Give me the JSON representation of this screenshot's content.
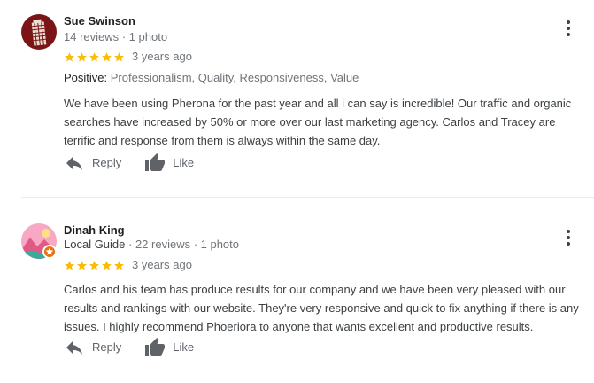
{
  "reviews": [
    {
      "author": "Sue Swinson",
      "local_guide": "",
      "meta": "14 reviews · 1 photo",
      "rating": 5,
      "date": "3 years ago",
      "positive_label": "Positive:",
      "positive_items": "Professionalism, Quality, Responsiveness, Value",
      "text": "We have been using Pherona for the past year and all i can say is incredible! Our traffic and organic searches have increased by 50% or more over our last marketing agency. Carlos and Tracey are terrific and response from them is always within the same day.",
      "reply_label": "Reply",
      "like_label": "Like"
    },
    {
      "author": "Dinah King",
      "local_guide": "Local Guide",
      "meta": " · 22 reviews · 1 photo",
      "rating": 5,
      "date": "3 years ago",
      "text": "Carlos and his team has produce results for our company and we have been very pleased with our results and rankings with our website. They're very responsive and quick to fix anything if there is any issues. I highly recommend Phoeriora to anyone that wants excellent and productive results.",
      "reply_label": "Reply",
      "like_label": "Like"
    }
  ],
  "colors": {
    "star": "#fbbc04",
    "name": "#202124",
    "secondary": "#70757a",
    "body": "#3c4043",
    "icon": "#5f6368",
    "guide_badge": "#e8710a"
  },
  "icons": {
    "reply": "reply-arrow-icon",
    "like": "thumbs-up-icon",
    "more": "more-vert-icon",
    "star": "star-icon",
    "guide": "local-guide-badge-icon"
  }
}
